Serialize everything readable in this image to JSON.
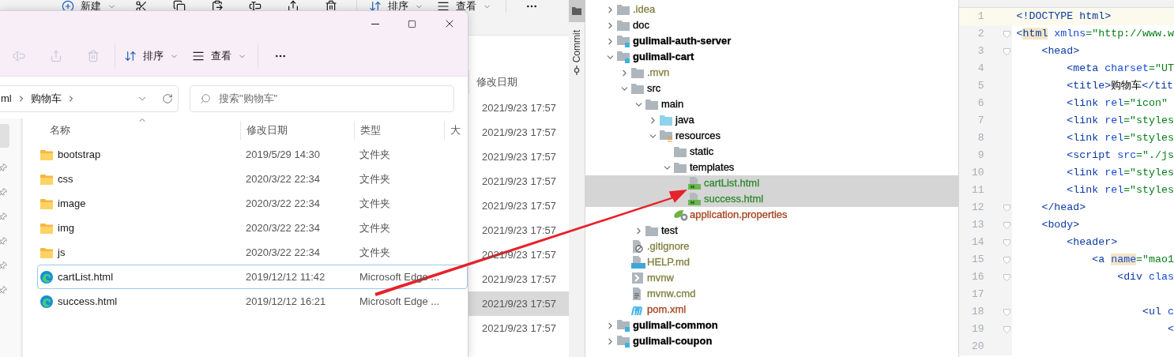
{
  "back_window": {
    "toolbar": [
      {
        "kind": "new",
        "label": "新建"
      },
      {
        "kind": "cut"
      },
      {
        "kind": "copy"
      },
      {
        "kind": "paste"
      },
      {
        "kind": "rename"
      },
      {
        "kind": "share"
      },
      {
        "kind": "delete"
      },
      {
        "kind": "sort",
        "label": "排序"
      },
      {
        "kind": "view",
        "label": "查看"
      },
      {
        "kind": "more"
      }
    ],
    "column_header": "修改日期",
    "rows": [
      {
        "modified": "2021/9/23 17:57",
        "selected": false
      },
      {
        "modified": "2021/9/23 17:57",
        "selected": false
      },
      {
        "modified": "2021/9/23 17:57",
        "selected": false
      },
      {
        "modified": "2021/9/23 17:57",
        "selected": false
      },
      {
        "modified": "2021/9/23 17:57",
        "selected": false
      },
      {
        "modified": "2021/9/23 17:57",
        "selected": false
      },
      {
        "modified": "2021/9/23 17:57",
        "selected": false
      },
      {
        "modified": "2021/9/23 17:57",
        "selected": false
      },
      {
        "modified": "2021/9/23 17:57",
        "selected": true
      },
      {
        "modified": "2021/9/23 17:57",
        "selected": false
      }
    ]
  },
  "front_window": {
    "toolbar": [
      {
        "kind": "rename",
        "disabled": true
      },
      {
        "kind": "share",
        "disabled": true
      },
      {
        "kind": "delete",
        "disabled": true
      },
      {
        "kind": "sort",
        "label": "排序",
        "disabled": false
      },
      {
        "kind": "view",
        "label": "查看",
        "disabled": false
      },
      {
        "kind": "more",
        "disabled": false
      }
    ],
    "address": {
      "crumbs": [
        "ml",
        "购物车"
      ]
    },
    "search": {
      "placeholder": "搜索\"购物车\""
    },
    "columns": [
      "名称",
      "修改日期",
      "类型",
      "大"
    ],
    "files": [
      {
        "kind": "folder",
        "name": "bootstrap",
        "modified": "2019/5/29 14:30",
        "type": "文件夹",
        "selected": false
      },
      {
        "kind": "folder",
        "name": "css",
        "modified": "2020/3/22 22:34",
        "type": "文件夹",
        "selected": false
      },
      {
        "kind": "folder",
        "name": "image",
        "modified": "2020/3/22 22:34",
        "type": "文件夹",
        "selected": false
      },
      {
        "kind": "folder",
        "name": "img",
        "modified": "2020/3/22 22:34",
        "type": "文件夹",
        "selected": false
      },
      {
        "kind": "folder",
        "name": "js",
        "modified": "2020/3/22 22:34",
        "type": "文件夹",
        "selected": false
      },
      {
        "kind": "edge",
        "name": "cartList.html",
        "modified": "2019/12/12 11:42",
        "type": "Microsoft Edge ...",
        "selected": true
      },
      {
        "kind": "edge",
        "name": "success.html",
        "modified": "2019/12/12 16:21",
        "type": "Microsoft Edge ...",
        "selected": false
      }
    ]
  },
  "ide": {
    "side_tab": "Commit",
    "tree": [
      {
        "name": ".idea",
        "kind": "folder",
        "expanded": false,
        "color": "#808040",
        "selected": false
      },
      {
        "name": "doc",
        "kind": "folder",
        "expanded": false,
        "color": "#000000",
        "selected": false
      },
      {
        "name": "gulimall-auth-server",
        "kind": "module",
        "expanded": false,
        "color": "#000000",
        "selected": false
      },
      {
        "name": "gulimall-cart",
        "kind": "module",
        "expanded": true,
        "color": "#000000",
        "selected": false,
        "children": [
          {
            "name": ".mvn",
            "kind": "folder",
            "expanded": false,
            "color": "#808040",
            "selected": false
          },
          {
            "name": "src",
            "kind": "folder",
            "expanded": true,
            "color": "#000000",
            "selected": false,
            "children": [
              {
                "name": "main",
                "kind": "folder",
                "expanded": true,
                "color": "#000000",
                "selected": false,
                "children": [
                  {
                    "name": "java",
                    "kind": "source-folder",
                    "expanded": false,
                    "color": "#000000",
                    "selected": false
                  },
                  {
                    "name": "resources",
                    "kind": "resource-folder",
                    "expanded": true,
                    "color": "#000000",
                    "selected": false,
                    "children": [
                      {
                        "name": "static",
                        "kind": "folder",
                        "color": "#000000",
                        "selected": false
                      },
                      {
                        "name": "templates",
                        "kind": "folder",
                        "expanded": true,
                        "color": "#000000",
                        "selected": false,
                        "children": [
                          {
                            "name": "cartList.html",
                            "kind": "html",
                            "color": "#2f8a2f",
                            "selected": true
                          },
                          {
                            "name": "success.html",
                            "kind": "html",
                            "color": "#2f8a2f",
                            "selected": true
                          }
                        ]
                      },
                      {
                        "name": "application.properties",
                        "kind": "properties",
                        "color": "#a6411c",
                        "selected": false
                      }
                    ]
                  }
                ]
              },
              {
                "name": "test",
                "kind": "folder",
                "expanded": false,
                "color": "#000000",
                "selected": false
              }
            ]
          },
          {
            "name": ".gitignore",
            "kind": "gitignore",
            "color": "#808040",
            "selected": false
          },
          {
            "name": "HELP.md",
            "kind": "markdown",
            "color": "#808040",
            "selected": false
          },
          {
            "name": "mvnw",
            "kind": "script",
            "color": "#808040",
            "selected": false
          },
          {
            "name": "mvnw.cmd",
            "kind": "text",
            "color": "#808040",
            "selected": false
          },
          {
            "name": "pom.xml",
            "kind": "maven",
            "color": "#a6411c",
            "selected": false
          }
        ]
      },
      {
        "name": "gulimall-common",
        "kind": "module",
        "expanded": false,
        "color": "#000000",
        "selected": false
      },
      {
        "name": "gulimall-coupon",
        "kind": "module",
        "expanded": false,
        "color": "#000000",
        "selected": false
      }
    ]
  },
  "editor": {
    "lines": [
      {
        "number": "1",
        "fold": false,
        "current": true,
        "segments": [
          {
            "kind": "tag",
            "text": "<!DOCTYPE html>"
          }
        ]
      },
      {
        "number": "2",
        "fold": true,
        "current": false,
        "segments": [
          {
            "kind": "tag",
            "text": "<"
          },
          {
            "kind": "tag-highlight",
            "text": "html"
          },
          {
            "kind": "attr",
            "text": " xmlns"
          },
          {
            "kind": "value",
            "text": "=\"http://www.w"
          }
        ]
      },
      {
        "number": "3",
        "fold": true,
        "current": false,
        "segments": [
          {
            "kind": "tag",
            "text": "    <head>"
          }
        ]
      },
      {
        "number": "4",
        "fold": false,
        "current": false,
        "segments": [
          {
            "kind": "tag",
            "text": "        <meta"
          },
          {
            "kind": "attr",
            "text": " charset"
          },
          {
            "kind": "value",
            "text": "=\"UT"
          }
        ]
      },
      {
        "number": "5",
        "fold": false,
        "current": false,
        "segments": [
          {
            "kind": "tag",
            "text": "        <title>"
          },
          {
            "kind": "text",
            "text": "购物车"
          },
          {
            "kind": "tag",
            "text": "</tit"
          }
        ]
      },
      {
        "number": "6",
        "fold": false,
        "current": false,
        "segments": [
          {
            "kind": "tag",
            "text": "        <link"
          },
          {
            "kind": "attr",
            "text": " rel"
          },
          {
            "kind": "value",
            "text": "=\"icon\""
          }
        ]
      },
      {
        "number": "7",
        "fold": false,
        "current": false,
        "segments": [
          {
            "kind": "tag",
            "text": "        <link"
          },
          {
            "kind": "attr",
            "text": " rel"
          },
          {
            "kind": "value",
            "text": "=\"styles"
          }
        ]
      },
      {
        "number": "8",
        "fold": false,
        "current": false,
        "segments": [
          {
            "kind": "tag",
            "text": "        <link"
          },
          {
            "kind": "attr",
            "text": " rel"
          },
          {
            "kind": "value",
            "text": "=\"styles"
          }
        ]
      },
      {
        "number": "9",
        "fold": false,
        "current": false,
        "segments": [
          {
            "kind": "tag",
            "text": "        <script"
          },
          {
            "kind": "attr",
            "text": " src"
          },
          {
            "kind": "value",
            "text": "=\"./js"
          }
        ]
      },
      {
        "number": "10",
        "fold": false,
        "current": false,
        "segments": [
          {
            "kind": "tag",
            "text": "        <link"
          },
          {
            "kind": "attr",
            "text": " rel"
          },
          {
            "kind": "value",
            "text": "=\"styles"
          }
        ]
      },
      {
        "number": "11",
        "fold": false,
        "current": false,
        "segments": [
          {
            "kind": "tag",
            "text": "        <link"
          },
          {
            "kind": "attr",
            "text": " rel"
          },
          {
            "kind": "value",
            "text": "=\"styles"
          }
        ]
      },
      {
        "number": "12",
        "fold": true,
        "current": false,
        "segments": [
          {
            "kind": "tag",
            "text": "    </head>"
          }
        ]
      },
      {
        "number": "13",
        "fold": true,
        "current": false,
        "segments": [
          {
            "kind": "tag",
            "text": "    <body>"
          }
        ]
      },
      {
        "number": "14",
        "fold": true,
        "current": false,
        "segments": [
          {
            "kind": "tag",
            "text": "        <header>"
          }
        ]
      },
      {
        "number": "15",
        "fold": true,
        "current": false,
        "segments": [
          {
            "kind": "tag",
            "text": "            <a "
          },
          {
            "kind": "attr-highlight",
            "text": "name"
          },
          {
            "kind": "value",
            "text": "=\"mao1"
          }
        ]
      },
      {
        "number": "16",
        "fold": true,
        "current": false,
        "segments": [
          {
            "kind": "tag",
            "text": "                <div"
          },
          {
            "kind": "attr",
            "text": " clas"
          }
        ]
      },
      {
        "number": "17",
        "fold": false,
        "current": false
      },
      {
        "number": "18",
        "fold": true,
        "current": false,
        "segments": [
          {
            "kind": "tag",
            "text": "                    <ul"
          },
          {
            "kind": "attr",
            "text": " c"
          }
        ]
      },
      {
        "number": "19",
        "fold": true,
        "current": false,
        "segments": [
          {
            "kind": "tag",
            "text": "                        <"
          }
        ]
      },
      {
        "number": "20",
        "fold": false,
        "current": false
      }
    ]
  }
}
